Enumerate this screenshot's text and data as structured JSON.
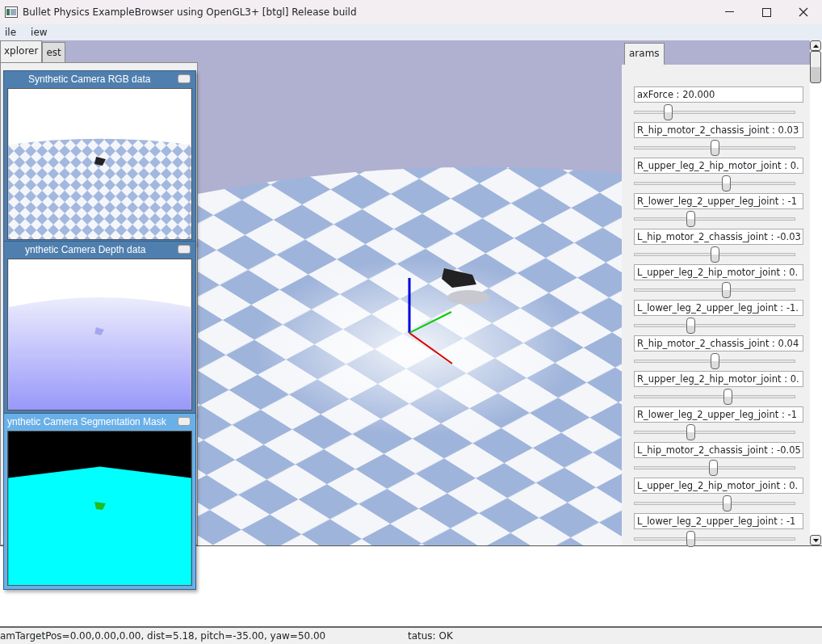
{
  "window": {
    "title": "Bullet Physics ExampleBrowser using OpenGL3+ [btgl] Release build"
  },
  "menu": [
    {
      "label": "ile"
    },
    {
      "label": "iew"
    }
  ],
  "left_tabs": [
    {
      "label": "xplorer",
      "selected": true
    },
    {
      "label": "est",
      "selected": false
    }
  ],
  "camera_windows": [
    {
      "title": "Synthetic Camera RGB data",
      "kind": "rgb"
    },
    {
      "title": "ynthetic Camera Depth data",
      "kind": "depth"
    },
    {
      "title": "ynthetic Camera Segmentation Mask",
      "kind": "segmentation"
    }
  ],
  "params_tab": {
    "label": "arams",
    "selected": true
  },
  "params": [
    {
      "label": "axForce : 20.000",
      "level": 0.21
    },
    {
      "label": "R_hip_motor_2_chassis_joint : 0.03",
      "level": 0.5
    },
    {
      "label": "R_upper_leg_2_hip_motor_joint : 0.",
      "level": 0.57
    },
    {
      "label": "R_lower_leg_2_upper_leg_joint : -1",
      "level": 0.35
    },
    {
      "label": "L_hip_motor_2_chassis_joint : -0.03",
      "level": 0.5
    },
    {
      "label": "L_upper_leg_2_hip_motor_joint : 0.",
      "level": 0.57
    },
    {
      "label": "L_lower_leg_2_upper_leg_joint : -1.",
      "level": 0.35
    },
    {
      "label": "R_hip_motor_2_chassis_joint : 0.04",
      "level": 0.5
    },
    {
      "label": "R_upper_leg_2_hip_motor_joint : 0.",
      "level": 0.58
    },
    {
      "label": "R_lower_leg_2_upper_leg_joint : -1",
      "level": 0.35
    },
    {
      "label": "L_hip_motor_2_chassis_joint : -0.05",
      "level": 0.49
    },
    {
      "label": "L_upper_leg_2_hip_motor_joint : 0.",
      "level": 0.575
    },
    {
      "label": "L_lower_leg_2_upper_leg_joint : -1",
      "level": 0.35
    }
  ],
  "status_bar": {
    "camera": "amTargetPos=0.00,0.00,0.00, dist=5.18, pitch=-35.00, yaw=50.00",
    "status": "tatus: OK"
  }
}
